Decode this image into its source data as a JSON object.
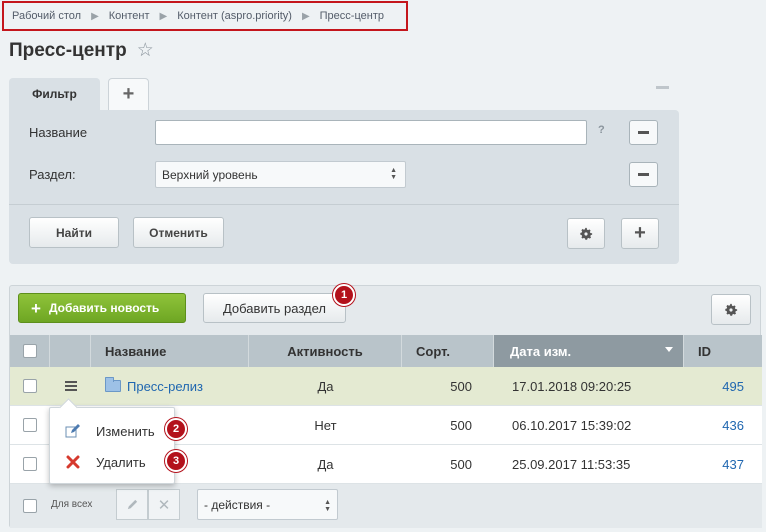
{
  "breadcrumb": [
    "Рабочий стол",
    "Контент",
    "Контент (aspro.priority)",
    "Пресс-центр"
  ],
  "page_title": "Пресс-центр",
  "filter": {
    "tab_label": "Фильтр",
    "fields": {
      "name_label": "Название",
      "name_value": "",
      "section_label": "Раздел:",
      "section_value": "Верхний уровень"
    },
    "help": "?",
    "find_label": "Найти",
    "cancel_label": "Отменить"
  },
  "toolbar": {
    "add_news_label": "Добавить новость",
    "add_section_label": "Добавить раздел"
  },
  "table": {
    "columns": [
      "Название",
      "Активность",
      "Сорт.",
      "Дата изм.",
      "ID"
    ],
    "sorted_column": "Дата изм.",
    "rows": [
      {
        "name": "Пресс-релиз",
        "active": "Да",
        "sort": "500",
        "date": "17.01.2018 09:20:25",
        "id": "495"
      },
      {
        "name": "",
        "active": "Нет",
        "sort": "500",
        "date": "06.10.2017 15:39:02",
        "id": "436"
      },
      {
        "name": "",
        "active": "Да",
        "sort": "500",
        "date": "25.09.2017 11:53:35",
        "id": "437"
      }
    ]
  },
  "context_menu": {
    "edit_label": "Изменить",
    "delete_label": "Удалить"
  },
  "badges": [
    "1",
    "2",
    "3"
  ],
  "footer": {
    "for_all_label": "Для всех",
    "actions_value": "- действия -"
  },
  "colors": {
    "accent_green": "#7cb52e",
    "badge_red": "#b3111b",
    "link_blue": "#2067b0",
    "highlight_box": "#c4161c"
  }
}
